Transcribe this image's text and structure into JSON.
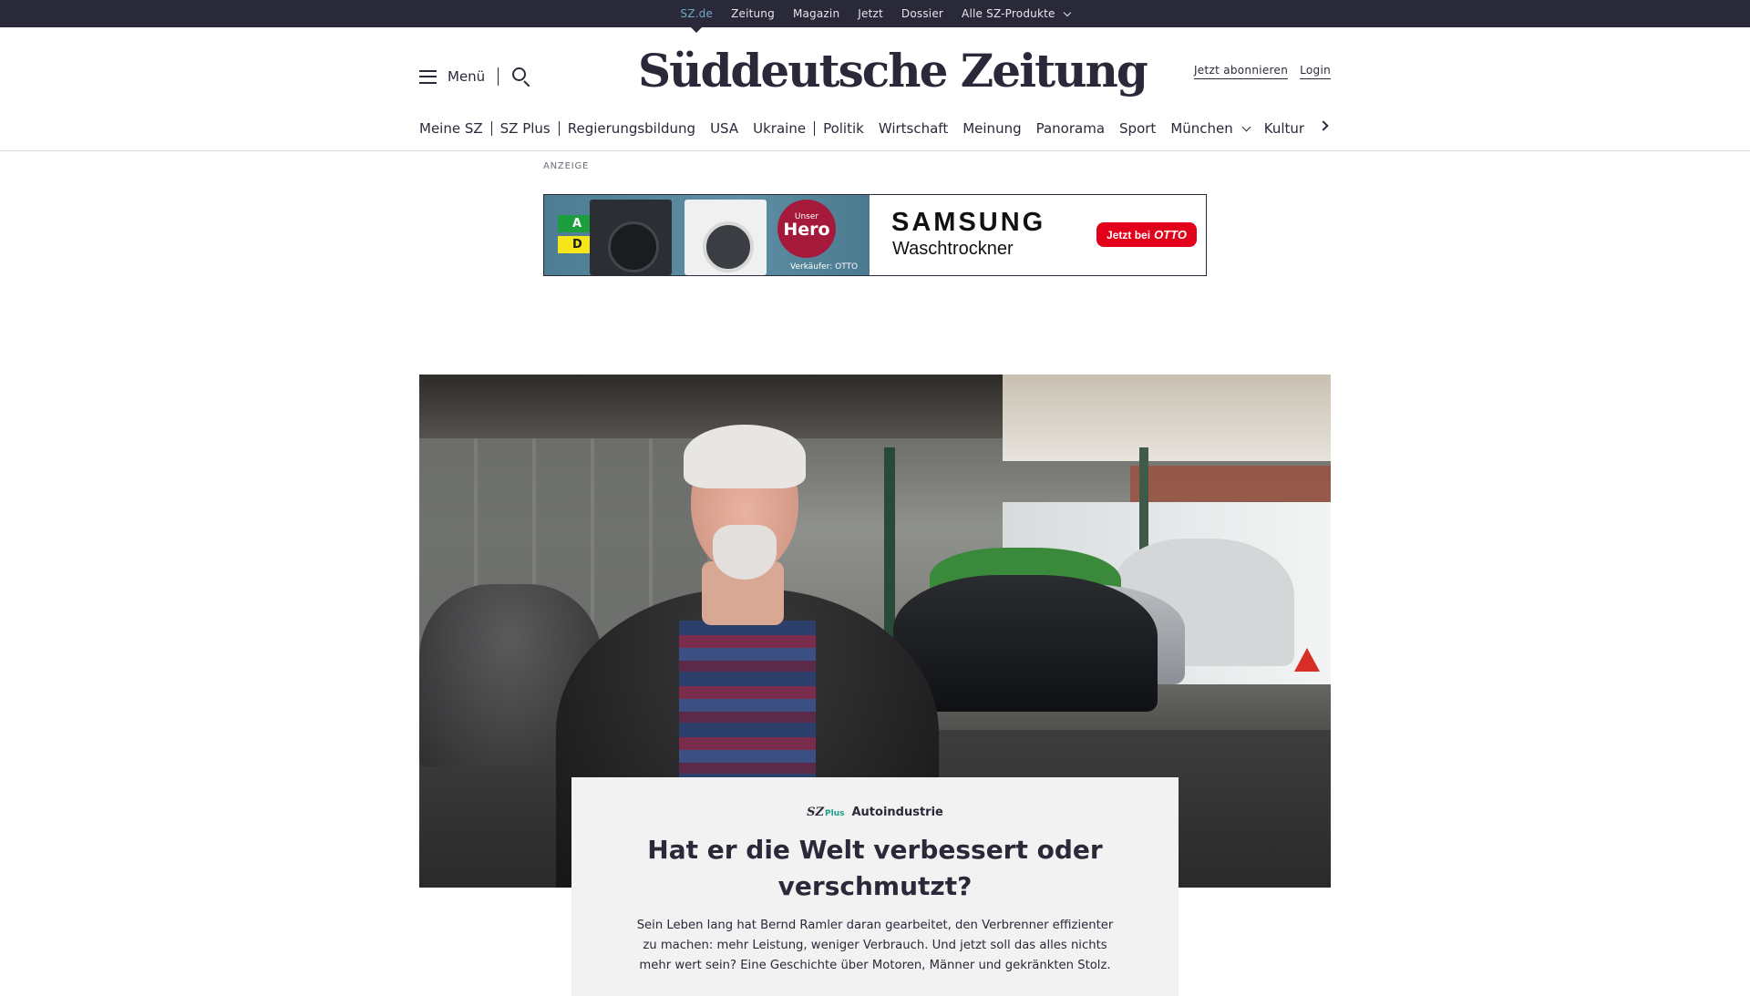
{
  "topbar": {
    "links": [
      "SZ.de",
      "Zeitung",
      "Magazin",
      "Jetzt",
      "Dossier",
      "Alle SZ-Produkte"
    ]
  },
  "header": {
    "menu_label": "Menü",
    "logo": "Süddeutsche Zeitung",
    "subscribe": "Jetzt abonnieren",
    "login": "Login"
  },
  "nav": {
    "items": [
      "Meine SZ",
      "SZ Plus",
      "Regierungsbildung",
      "USA",
      "Ukraine",
      "Politik",
      "Wirtschaft",
      "Meinung",
      "Panorama",
      "Sport",
      "München",
      "Kultur"
    ]
  },
  "ad": {
    "label": "ANZEIGE",
    "energy_a": "A",
    "energy_d": "D",
    "badge_small": "Unser",
    "badge_big": "Hero",
    "seller": "Verkäufer: OTTO",
    "brand": "SAMSUNG",
    "product": "Waschtrockner",
    "cta_prefix": "Jetzt bei",
    "cta_brand": "OTTO"
  },
  "article": {
    "szplus_sz": "SZ",
    "szplus_plus": "Plus",
    "kicker": "Autoindustrie",
    "headline": "Hat er die Welt verbessert oder verschmutzt?",
    "teaser": "Sein Leben lang hat Bernd Ramler daran gearbeitet, den Verbrenner effizienter zu machen: mehr Leistung, weniger Verbrauch. Und jetzt soll das alles nichts mehr wert sein? Eine Geschichte über Motoren, Männer und gekränkten Stolz."
  },
  "colors": {
    "brand_dark": "#29293a",
    "topbar_active": "#71a6c7",
    "ad_cta": "#e3001b",
    "szplus_accent": "#1c9e8c",
    "card_bg": "#f2f2f2"
  }
}
